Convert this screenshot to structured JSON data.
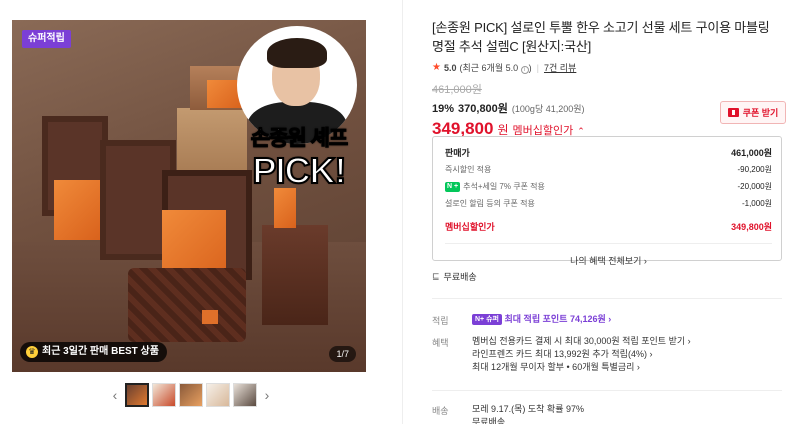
{
  "gallery": {
    "badge": "슈퍼적립",
    "promo_sub": "손종원 셰프",
    "promo_main": "PICK!",
    "best_badge": "최근 3일간 판매 BEST 상품",
    "counter": "1/7",
    "thumb_prev": "‹",
    "thumb_next": "›"
  },
  "product": {
    "title": "[손종원 PICK] 설로인 투뿔 한우 소고기 선물 세트 구이용 마블링 명절 추석 설렘C [원산지:국산]",
    "rating": "5.0",
    "rating_detail": "(최근 6개월 5.0",
    "rating_detail_close": ")",
    "review_link": "7건 리뷰",
    "original_price": "461,000원",
    "discount_rate": "19%",
    "discount_price": "370,800원",
    "unit_price": "(100g당 41,200원)",
    "member_price": "349,800",
    "member_won": "원",
    "member_label": "멤버십할인가",
    "coupon_button": "쿠폰 받기"
  },
  "price_box": {
    "head_label": "판매가",
    "head_value": "461,000원",
    "lines": [
      {
        "label": "즉시할인 적용",
        "value": "-90,200원"
      },
      {
        "label": "추석+세일 7% 쿠폰 적용",
        "value": "-20,000원",
        "badge": "N +"
      },
      {
        "label": "설로인 할림 등의 쿠폰 적용",
        "value": "-1,000원"
      }
    ],
    "total_label": "멤버십할인가",
    "total_value": "349,800원",
    "benefits_button": "나의 혜택 전체보기 ›"
  },
  "shipping": {
    "free_label": "무료배송"
  },
  "points": {
    "label": "적립",
    "badge": "N+ 슈퍼",
    "text": "최대 적립 포인트 74,126원 ›"
  },
  "benefits": {
    "label": "혜택",
    "lines": [
      "멤버십 전용카드 결제 시 최대 30,000원 적립 포인트 받기 ›",
      "라인프렌즈 카드 최대 13,992원 추가 적립(4%) ›",
      "최대 12개월 무이자 할부 • 60개월 특별금리 ›"
    ]
  },
  "delivery": {
    "label": "배송",
    "lines": [
      "모레 9.17.(목) 도착 확률 97%",
      "무료배송"
    ]
  },
  "colors": {
    "accent_red": "#e0122b",
    "purple": "#7b3fd6",
    "naver_green": "#03c75a"
  }
}
